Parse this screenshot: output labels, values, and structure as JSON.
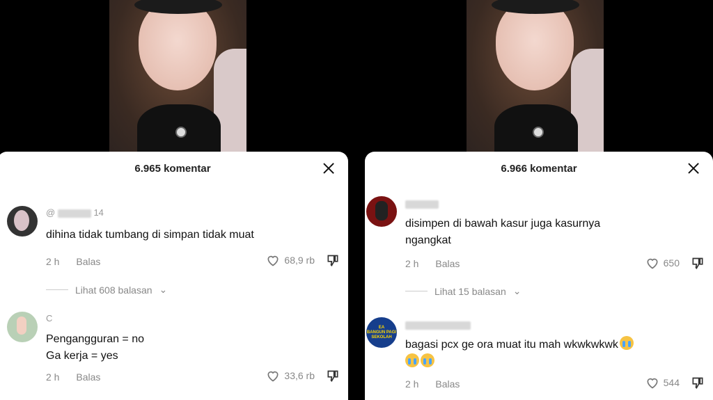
{
  "panels": [
    {
      "header": {
        "count": "6.965 komentar"
      },
      "comments": [
        {
          "username": "@",
          "username_suffix": "14",
          "text": "dihina tidak tumbang di simpan tidak muat",
          "time": "2 h",
          "reply": "Balas",
          "likes": "68,9 rb",
          "view_replies": "Lihat 608 balasan"
        },
        {
          "username": "C",
          "text_line1": "Pengangguran = no",
          "text_line2": "Ga kerja = yes",
          "time": "2 h",
          "reply": "Balas",
          "likes": "33,6 rb"
        }
      ]
    },
    {
      "header": {
        "count": "6.966 komentar"
      },
      "comments": [
        {
          "text_line1": "disimpen di bawah kasur juga kasurnya",
          "text_line2": "ngangkat",
          "time": "2 h",
          "reply": "Balas",
          "likes": "650",
          "view_replies": "Lihat 15 balasan"
        },
        {
          "text": "bagasi pcx ge ora muat itu mah wkwkwkwk",
          "avatar_text_line1": "EA",
          "avatar_text_line2": "BANGUN PAGI",
          "avatar_text_line3": "SEKOLAH",
          "time": "2 h",
          "reply": "Balas",
          "likes": "544"
        }
      ]
    }
  ],
  "colors": {
    "sheet": "#ffffff",
    "text": "#111111",
    "muted": "#888888",
    "background": "#000000"
  },
  "icons": [
    "close-icon",
    "heart-icon",
    "dislike-icon",
    "chevron-down-icon",
    "crying-emoji-icon"
  ]
}
